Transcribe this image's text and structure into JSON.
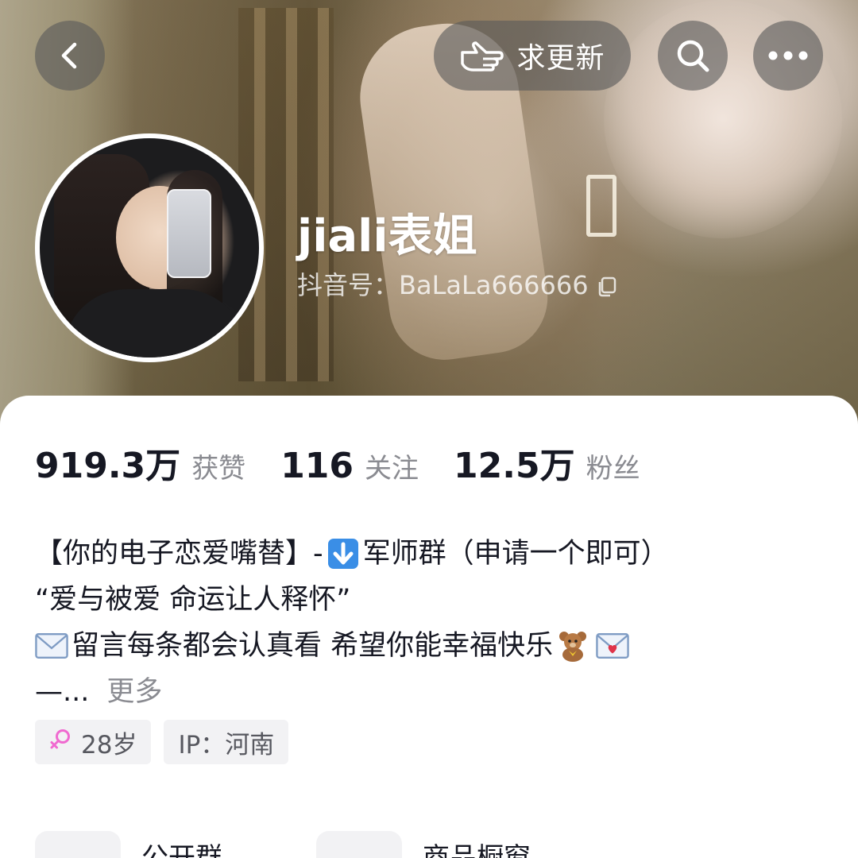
{
  "topbar": {
    "back_icon": "chevron-left-icon",
    "update_label": "求更新",
    "update_icon": "pointing-hand-icon",
    "search_icon": "search-icon",
    "more_icon": "more-dots-icon"
  },
  "profile": {
    "name": "jiali表姐",
    "douyin_id": "抖音号：BaLaLa666666",
    "copy_icon": "copy-icon"
  },
  "stats": [
    {
      "value": "919.3万",
      "label": "获赞"
    },
    {
      "value": "116",
      "label": "关注"
    },
    {
      "value": "12.5万",
      "label": "粉丝"
    }
  ],
  "bio": {
    "line1_a": "【你的电子恋爱嘴替】-",
    "line1_emoji": "⬇️",
    "line1_b": "军师群（申请一个即可）",
    "line2": "“爱与被爱 命运让人释怀”",
    "line3_emoji_start": "✉️",
    "line3_text": "留言每条都会认真看 希望你能幸福快乐",
    "line3_emoji_bear": "🧸",
    "line3_emoji_love_letter": "💌",
    "line4_text": "—...",
    "more_label": "更多"
  },
  "tags": {
    "age": "28岁",
    "age_icon": "female-icon",
    "ip": "IP：河南"
  },
  "shortcuts": [
    {
      "label": "公开群"
    },
    {
      "label": "商品橱窗"
    }
  ],
  "colors": {
    "primary_text": "#161823",
    "secondary_text": "#8a8b91",
    "tag_bg": "#f2f2f4",
    "female_accent": "#f06ad0",
    "envelope_blue": "#3a8ee6",
    "bear_brown": "#a66a3a"
  }
}
